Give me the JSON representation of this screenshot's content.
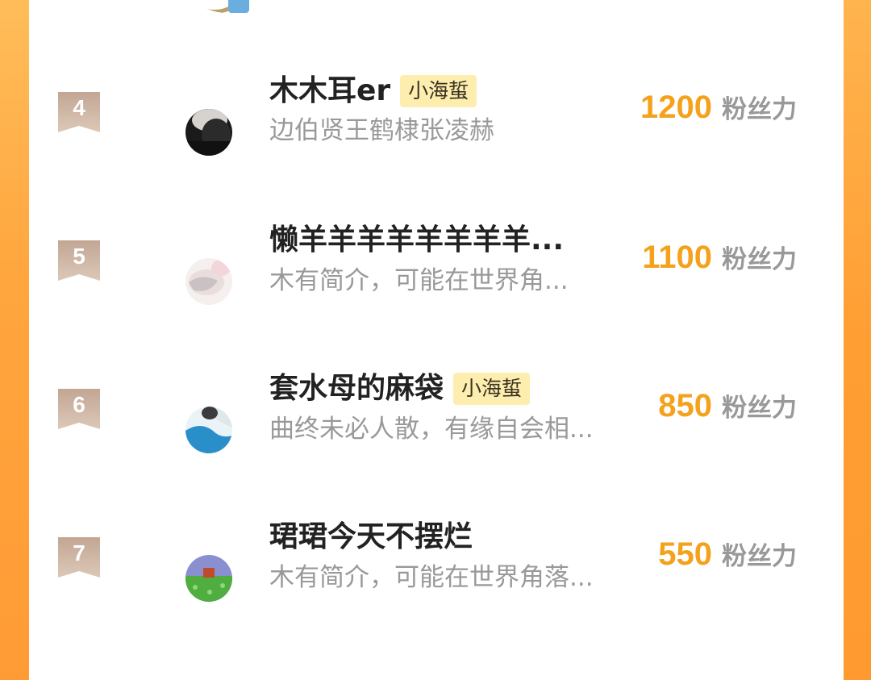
{
  "theme": {
    "accent": "#f4a21c",
    "frame": "#ffa63e",
    "badge": "#c9b09c",
    "tag_bg": "#fdeeb0"
  },
  "score_unit": "粉丝力",
  "rows": [
    {
      "rank": "4",
      "name": "木木耳er",
      "tag": "小海蜇",
      "bio": "边伯贤王鹤棣张凌赫",
      "score": "1200"
    },
    {
      "rank": "5",
      "name": "懒羊羊羊羊羊羊羊羊...",
      "tag": "",
      "bio": "木有简介，可能在世界角...",
      "score": "1100"
    },
    {
      "rank": "6",
      "name": "套水母的麻袋",
      "tag": "小海蜇",
      "bio": "曲终未必人散，有缘自会相...",
      "score": "850"
    },
    {
      "rank": "7",
      "name": "珺珺今天不摆烂",
      "tag": "",
      "bio": "木有简介，可能在世界角落...",
      "score": "550"
    }
  ]
}
